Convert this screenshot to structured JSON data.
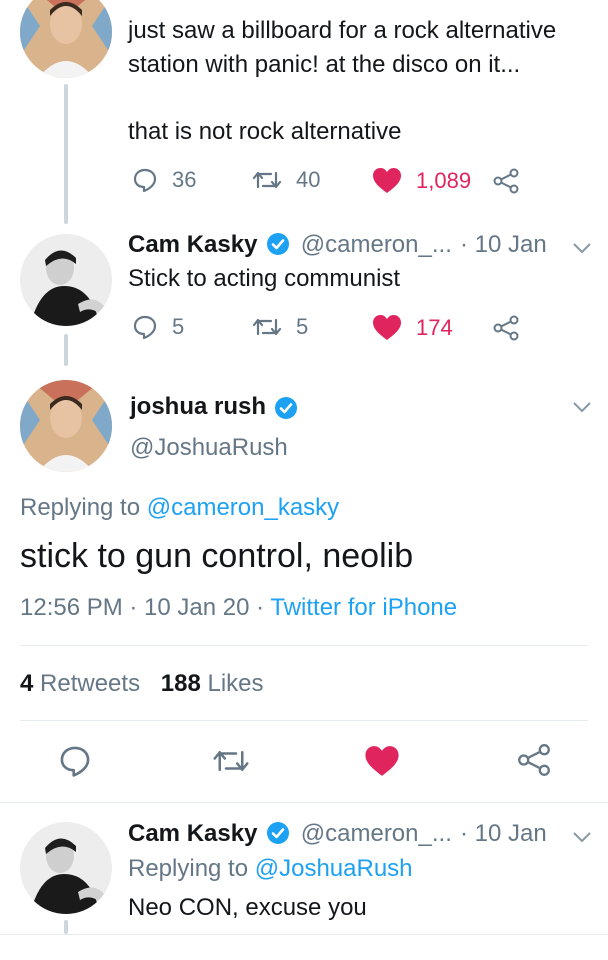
{
  "reply1": {
    "text_line1": "just saw a billboard for a rock alternative",
    "text_line2": "station with panic! at the disco on it...",
    "text_line3": "that is not rock alternative",
    "replies": "36",
    "retweets": "40",
    "likes": "1,089"
  },
  "reply2": {
    "name": "Cam Kasky",
    "handle": "@cameron_...",
    "date": "· 10 Jan",
    "text": "Stick to acting communist",
    "replies": "5",
    "retweets": "5",
    "likes": "174"
  },
  "main_tweet": {
    "name": "joshua rush",
    "handle": "@JoshuaRush",
    "replying_prefix": "Replying to",
    "replying_to": "@cameron_kasky",
    "text": "stick to gun control, neolib",
    "time": "12:56 PM · 10 Jan 20 ·",
    "source": "Twitter for iPhone",
    "retweet_count": "4",
    "retweet_label": "Retweets",
    "like_count": "188",
    "like_label": "Likes"
  },
  "reply3": {
    "name": "Cam Kasky",
    "handle": "@cameron_...",
    "date": "· 10 Jan",
    "replying_prefix": "Replying to",
    "replying_to": "@JoshuaRush",
    "text": "Neo CON, excuse you"
  },
  "colors": {
    "blue": "#1da1f2",
    "like_red": "#e0245e",
    "muted": "#657786",
    "line": "#ccd6dd"
  },
  "icons": {
    "reply": "speech-bubble-icon",
    "retweet": "retweet-icon",
    "like": "heart-icon",
    "share": "share-icon",
    "verified": "verified-badge-icon",
    "menu": "chevron-down-icon"
  }
}
